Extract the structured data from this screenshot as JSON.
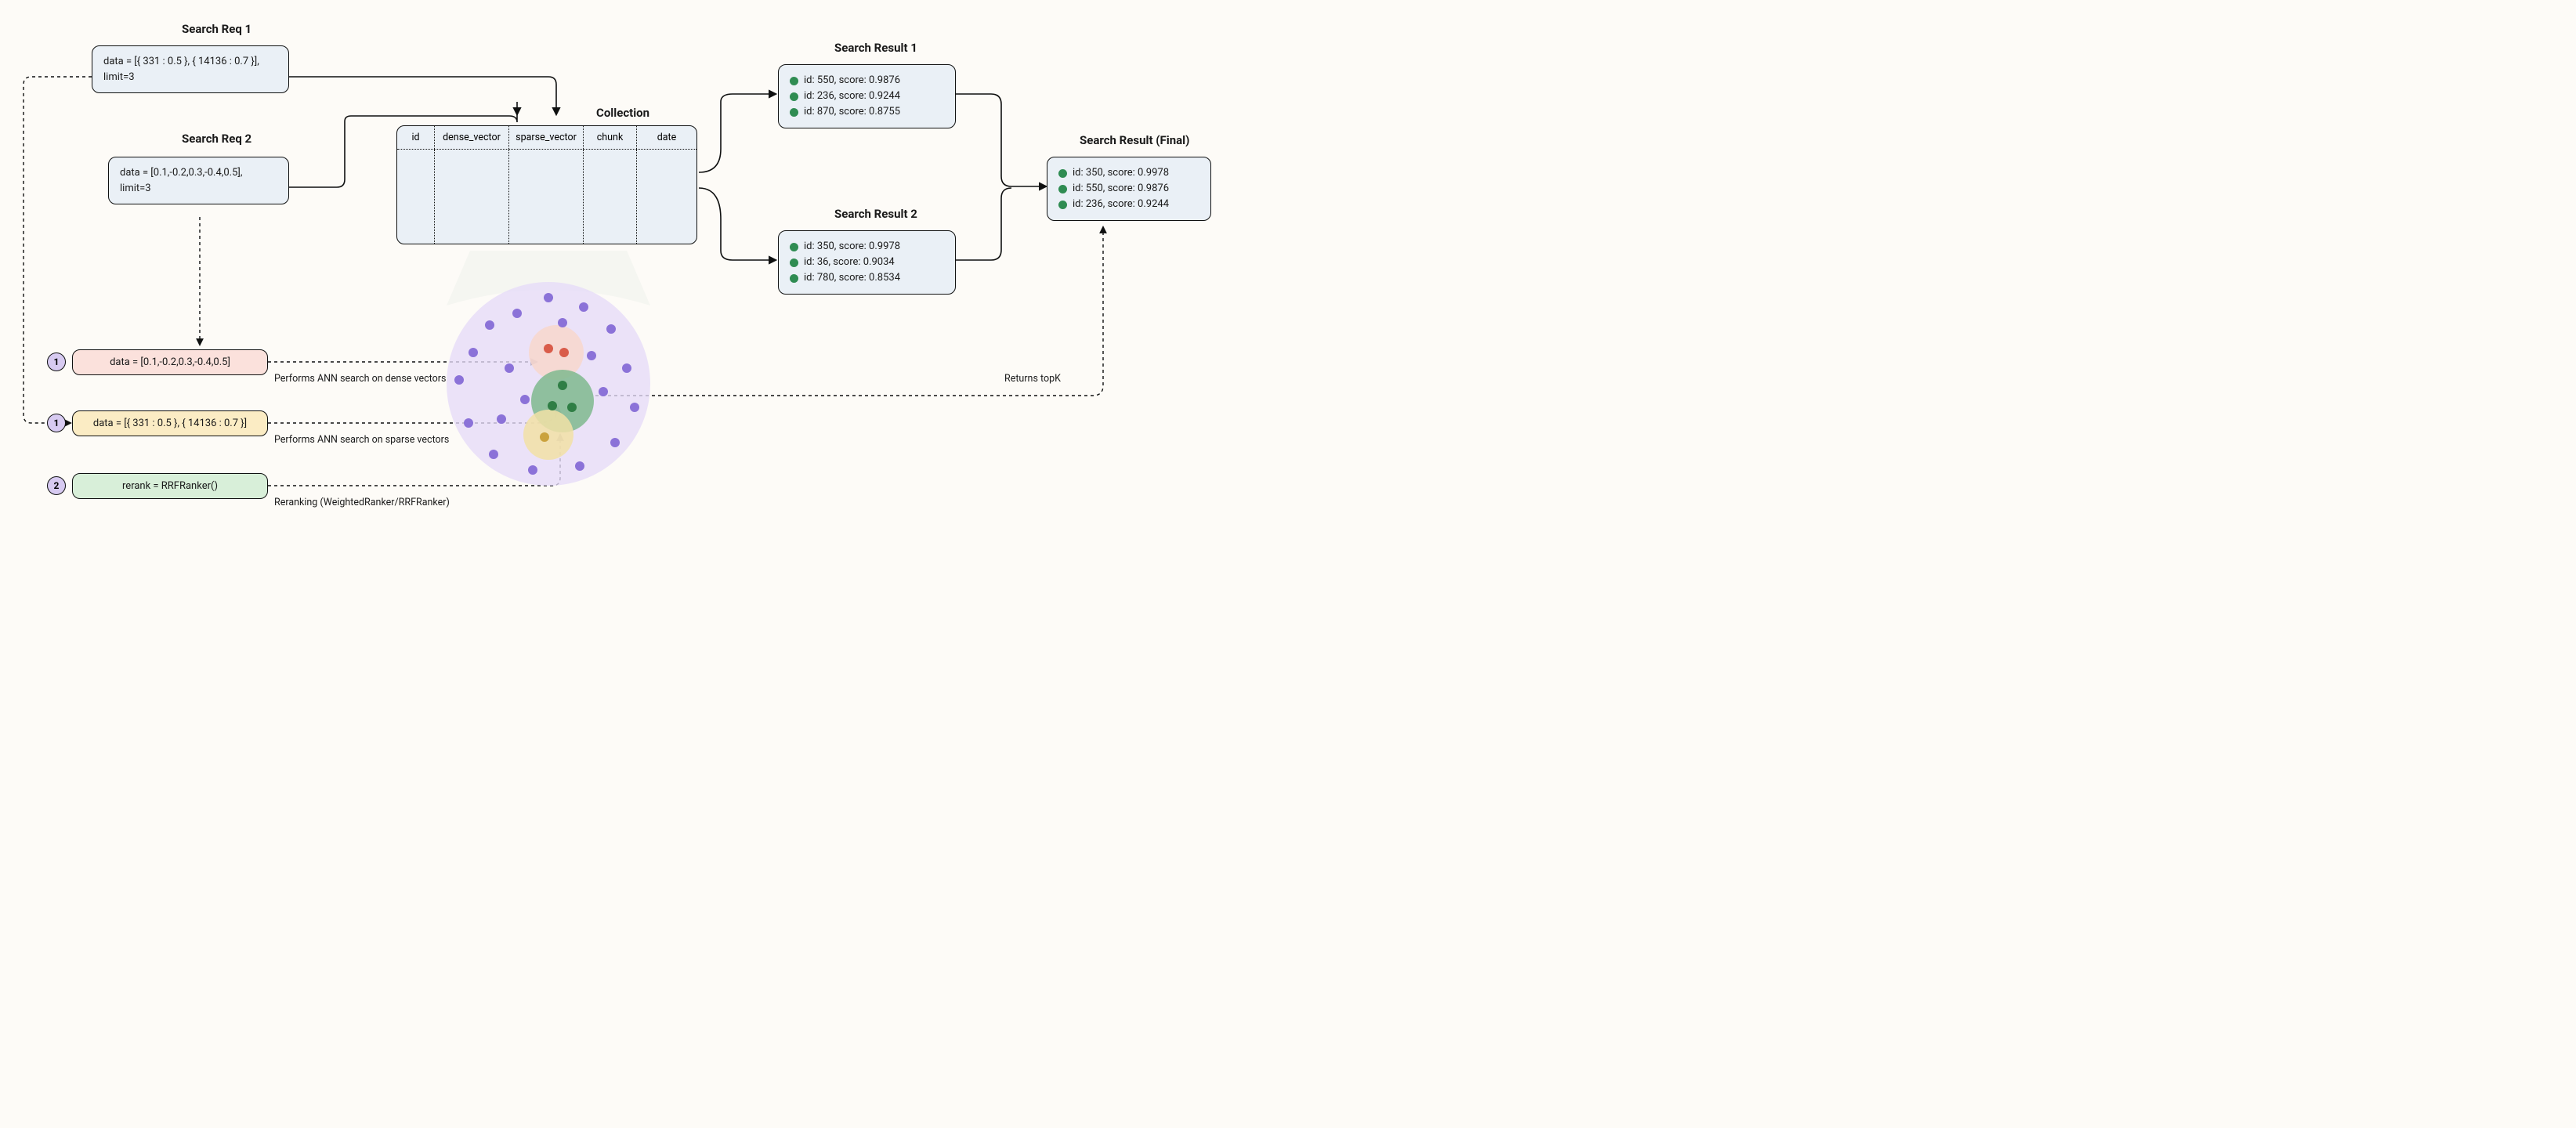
{
  "labels": {
    "req1": "Search Req 1",
    "req2": "Search Req 2",
    "collection": "Collection",
    "res1": "Search Result 1",
    "res2": "Search Result 2",
    "final": "Search Result (Final)"
  },
  "req1": {
    "line1": "data = [{ 331 : 0.5 }, { 14136 : 0.7 }],",
    "line2": "limit=3"
  },
  "req2": {
    "line1": "data = [0.1,-0.2,0.3,-0.4,0.5],",
    "line2": "limit=3"
  },
  "collection_cols": [
    "id",
    "dense_vector",
    "sparse_vector",
    "chunk",
    "date"
  ],
  "step1_dense": {
    "badge": "1",
    "text": "data = [0.1,-0.2,0.3,-0.4,0.5]",
    "caption": "Performs ANN search on dense vectors"
  },
  "step1_sparse": {
    "badge": "1",
    "text": "data = [{ 331 : 0.5 }, { 14136 : 0.7 }]",
    "caption": "Performs ANN search on sparse vectors"
  },
  "step2_rerank": {
    "badge": "2",
    "text": "rerank = RRFRanker()",
    "caption": "Reranking (WeightedRanker/RRFRanker)"
  },
  "res1_items": [
    "id: 550, score: 0.9876",
    "id: 236, score: 0.9244",
    "id: 870, score: 0.8755"
  ],
  "res2_items": [
    "id: 350, score: 0.9978",
    "id: 36, score: 0.9034",
    "id: 780, score: 0.8534"
  ],
  "final_items": [
    "id: 350, score: 0.9978",
    "id: 550, score: 0.9876",
    "id: 236, score: 0.9244"
  ],
  "topk_caption": "Returns topK"
}
